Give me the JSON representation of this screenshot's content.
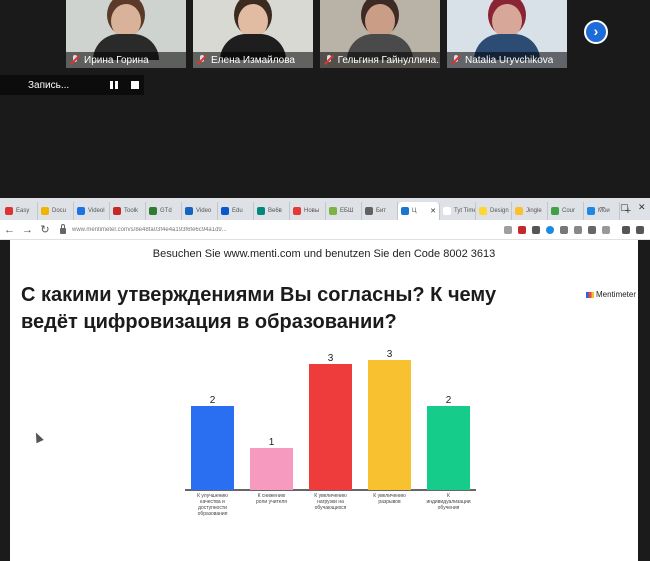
{
  "participants": [
    {
      "name": "Ирина Горина",
      "bg": "#cfd3cf",
      "skin": "#d9b29a",
      "hair": "#5b3a2a",
      "shirt": "#2a2a2a"
    },
    {
      "name": "Елена Измайлова",
      "bg": "#d9d9d4",
      "skin": "#e1bba2",
      "hair": "#3a2a20",
      "shirt": "#1e1e1e"
    },
    {
      "name": "Гельгиня Гайнуллина...",
      "bg": "#b9b2a6",
      "skin": "#c99d86",
      "hair": "#3d2a25",
      "shirt": "#4a4a4a"
    },
    {
      "name": "Natalia Uryvchikova",
      "bg": "#d8e0e8",
      "skin": "#d7a89a",
      "hair": "#8a2433",
      "shirt": "#2c4c73"
    }
  ],
  "recording": {
    "label": "Запись..."
  },
  "browser": {
    "tabs": [
      {
        "label": "Easy",
        "color": "#d33"
      },
      {
        "label": "Docu",
        "color": "#f0b400"
      },
      {
        "label": "Videol",
        "color": "#1a73e8"
      },
      {
        "label": "Toolk",
        "color": "#c62828"
      },
      {
        "label": "GTd",
        "color": "#2e7d32"
      },
      {
        "label": "Video",
        "color": "#1565c0"
      },
      {
        "label": "Edu",
        "color": "#0b57d0"
      },
      {
        "label": "Ве6в",
        "color": "#00897b"
      },
      {
        "label": "Новы",
        "color": "#e53935"
      },
      {
        "label": "ЕБШ",
        "color": "#7cb342"
      },
      {
        "label": "Бит",
        "color": "#616161"
      },
      {
        "label": "Ц",
        "color": "#1976d2",
        "active": true
      },
      {
        "label": "Tyt Time",
        "color": "#ffffff"
      },
      {
        "label": "Design",
        "color": "#fdd835"
      },
      {
        "label": "Jingle",
        "color": "#fbc02d"
      },
      {
        "label": "Cour",
        "color": "#43a047"
      },
      {
        "label": "Мои",
        "color": "#1e88e5"
      }
    ],
    "url": "www.mentimeter.com/s/8e48fa03f4e4a193f6fe6c94a1d9..."
  },
  "slide": {
    "visit_text": "Besuchen Sie www.menti.com und benutzen Sie den Code 8002 3613",
    "question": "С какими утверждениями Вы согласны? К чему ведёт цифровизация в образовании?",
    "brand": "Mentimeter"
  },
  "chart_data": {
    "type": "bar",
    "categories": [
      "К улучшению качества и доступности образования",
      "К снижению роли учителя",
      "К увеличению нагрузки на обучающихся",
      "К увеличению разрывов",
      "К индивидуализации обучения"
    ],
    "values": [
      2,
      1,
      3,
      3,
      2
    ],
    "colors": [
      "#2a6ff2",
      "#f79ac0",
      "#ee3b3b",
      "#f7c12f",
      "#16cc8a"
    ],
    "title": "",
    "xlabel": "",
    "ylabel": ""
  },
  "colors": {
    "accent": "#1f6bd8"
  }
}
